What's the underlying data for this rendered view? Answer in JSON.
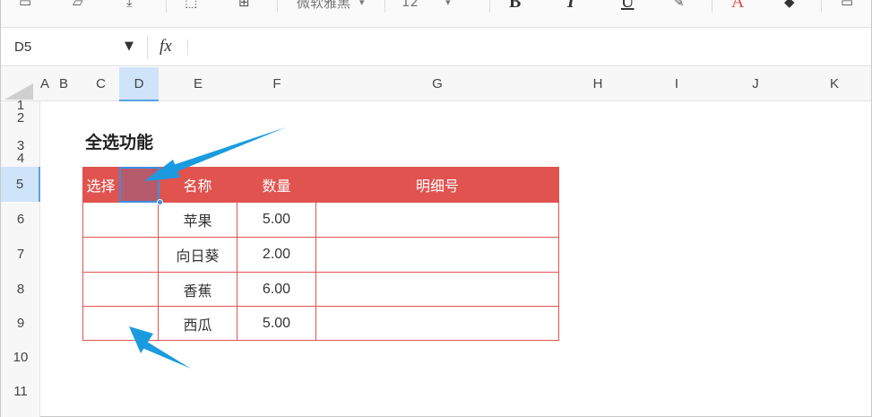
{
  "toolbar": {
    "font_name": "微软雅黑",
    "font_size": "12",
    "bold_label": "B",
    "italic_label": "I",
    "underline_label": "U",
    "font_color_label": "A"
  },
  "formula_bar": {
    "cell_ref": "D5",
    "fx_label": "fx",
    "formula_value": ""
  },
  "columns": [
    "A",
    "B",
    "C",
    "D",
    "E",
    "F",
    "G",
    "H",
    "I",
    "J",
    "K"
  ],
  "selected_column": "D",
  "rows": [
    "1",
    "2",
    "3",
    "4",
    "5",
    "6",
    "7",
    "8",
    "9",
    "10",
    "11"
  ],
  "selected_row": "5",
  "sheet": {
    "title": "全选功能",
    "table": {
      "headers": [
        "选择",
        "",
        "名称",
        "数量",
        "明细号"
      ],
      "rows": [
        {
          "name": "苹果",
          "qty": "5.00",
          "detail": ""
        },
        {
          "name": "向日葵",
          "qty": "2.00",
          "detail": ""
        },
        {
          "name": "香蕉",
          "qty": "6.00",
          "detail": ""
        },
        {
          "name": "西瓜",
          "qty": "5.00",
          "detail": ""
        }
      ]
    }
  },
  "colors": {
    "header_bg": "#e0534f",
    "selected_header_bg": "#b65b6c",
    "selection_border": "#3d8de0",
    "arrow": "#1a9be0"
  }
}
